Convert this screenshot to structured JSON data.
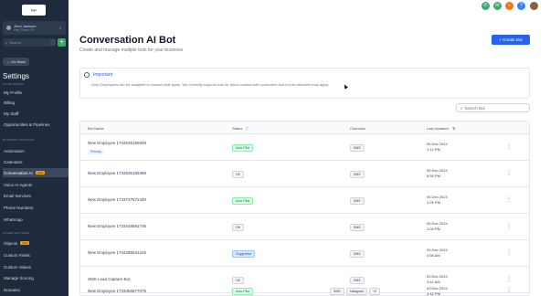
{
  "sidebar": {
    "logo_text": "logo",
    "account_name": "Jhon Jackson",
    "account_sub": "Hey There, FL",
    "search_placeholder": "Search",
    "back_label": "Go Back",
    "settings_title": "Settings",
    "sections": [
      "MY BUSINESS",
      "BUSINESS SERVICES",
      "OTHER SETTINGS"
    ],
    "items": [
      {
        "label": "My Profile"
      },
      {
        "label": "Billing"
      },
      {
        "label": "My Staff"
      },
      {
        "label": "Opportunities & Pipelines"
      },
      {
        "label": "Automation"
      },
      {
        "label": "Calendars"
      },
      {
        "label": "Conversation AI",
        "badge": "New",
        "active": true
      },
      {
        "label": "Voice AI Agents"
      },
      {
        "label": "Email Services"
      },
      {
        "label": "Phone Numbers"
      },
      {
        "label": "WhatsApp"
      },
      {
        "label": "Objects",
        "badge": "New"
      },
      {
        "label": "Custom Fields"
      },
      {
        "label": "Custom Values"
      },
      {
        "label": "Manage Scoring"
      },
      {
        "label": "Domains"
      }
    ]
  },
  "topbar": {
    "icons": [
      {
        "name": "phone-icon",
        "color": "#3ea86b"
      },
      {
        "name": "megaphone-icon",
        "color": "#3ea86b"
      },
      {
        "name": "bell-icon",
        "color": "#f97316"
      },
      {
        "name": "help-icon",
        "color": "#3b82f6"
      }
    ]
  },
  "main": {
    "title": "Conversation AI Bot",
    "subtitle": "Create and manage multiple bots for your business",
    "create_button": "+ Create Bot",
    "info_title": "Important",
    "info_text": "Only Employees can be assigned to contact chat types. We currently support bots for direct contact with customers and not all channels may apply.",
    "search_placeholder": "Search Bot",
    "columns": [
      "Bot Name",
      "Status",
      "Channels",
      "Last Updated"
    ],
    "rows": [
      {
        "name": "New Employee 1734636185849",
        "primary": "Primary",
        "status": "Auto-Pilot",
        "status_type": "active",
        "channels": [
          "SMS"
        ],
        "date": "05 Dec 2024",
        "time": "1:12 PM"
      },
      {
        "name": "New Employee 1734636185498",
        "status": "Off",
        "status_type": "off",
        "channels": [
          "SMS"
        ],
        "date": "05 Dec 2024",
        "time": "6:55 PM"
      },
      {
        "name": "New Employee 1733727572440",
        "status": "Auto-Pilot",
        "status_type": "active",
        "channels": [
          "SMS"
        ],
        "date": "05 Dec 2024",
        "time": "1:25 PM"
      },
      {
        "name": "New Employee 1733416591736",
        "status": "Off",
        "status_type": "off",
        "channels": [
          "SMS"
        ],
        "date": "05 Dec 2024",
        "time": "1:09 PM"
      },
      {
        "name": "New Employee 1734285531226",
        "status": "Suggestive",
        "status_type": "suggest",
        "channels": [
          "SMS"
        ],
        "date": "03 Dec 2024",
        "time": "4:58 AM"
      },
      {
        "name": "SMS Lead Capture Bot",
        "status": "Off",
        "status_type": "off",
        "channels": [
          "SMS"
        ],
        "date": "03 Dec 2024",
        "time": "3:41 AM"
      },
      {
        "name": "New Employee 1733456677076",
        "status": "Auto-Pilot",
        "status_type": "active",
        "channels": [
          "SMS",
          "Instagram",
          "+2"
        ],
        "date": "03 Dec 2024",
        "time": "4:42 PM"
      }
    ]
  }
}
